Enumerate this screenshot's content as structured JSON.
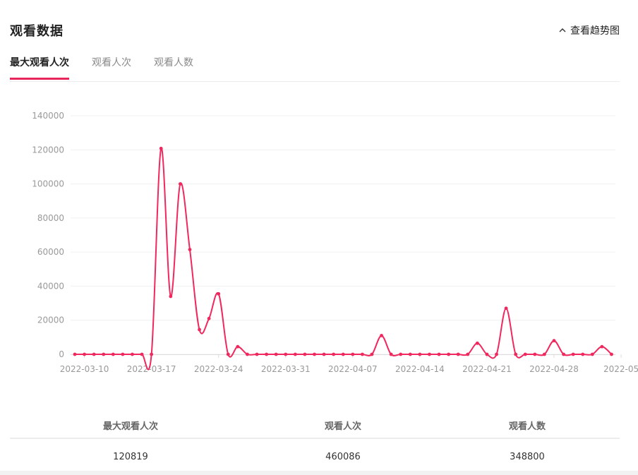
{
  "header": {
    "title": "观看数据",
    "trend_toggle": "查看趋势图"
  },
  "tabs": [
    {
      "label": "最大观看人次",
      "active": true
    },
    {
      "label": "观看人次",
      "active": false
    },
    {
      "label": "观看人数",
      "active": false
    }
  ],
  "colors": {
    "accent": "#e8265b",
    "line": "#f0285e"
  },
  "chart_data": {
    "type": "line",
    "title": "",
    "xlabel": "",
    "ylabel": "",
    "ylim": [
      0,
      140000
    ],
    "yticks": [
      "0",
      "20000",
      "40000",
      "60000",
      "80000",
      "100000",
      "120000",
      "140000"
    ],
    "xticks": [
      "2022-03-10",
      "2022-03-17",
      "2022-03-24",
      "2022-03-31",
      "2022-04-07",
      "2022-04-14",
      "2022-04-21",
      "2022-04-28",
      "2022-05"
    ],
    "grid": true,
    "legend": "none",
    "series": [
      {
        "start_date": "2022-03-09",
        "values": [
          0,
          0,
          0,
          0,
          0,
          0,
          0,
          0,
          0,
          120819,
          34000,
          100000,
          61500,
          14500,
          21000,
          35500,
          0,
          4500,
          0,
          0,
          0,
          0,
          0,
          0,
          0,
          0,
          0,
          0,
          0,
          0,
          0,
          0,
          11000,
          0,
          0,
          0,
          0,
          0,
          0,
          0,
          0,
          0,
          6500,
          0,
          0,
          27000,
          0,
          0,
          0,
          0,
          8000,
          0,
          0,
          0,
          0,
          4500,
          0
        ]
      }
    ]
  },
  "stats": {
    "headers": [
      "最大观看人次",
      "观看人次",
      "观看人数"
    ],
    "values": [
      "120819",
      "460086",
      "348800"
    ]
  }
}
